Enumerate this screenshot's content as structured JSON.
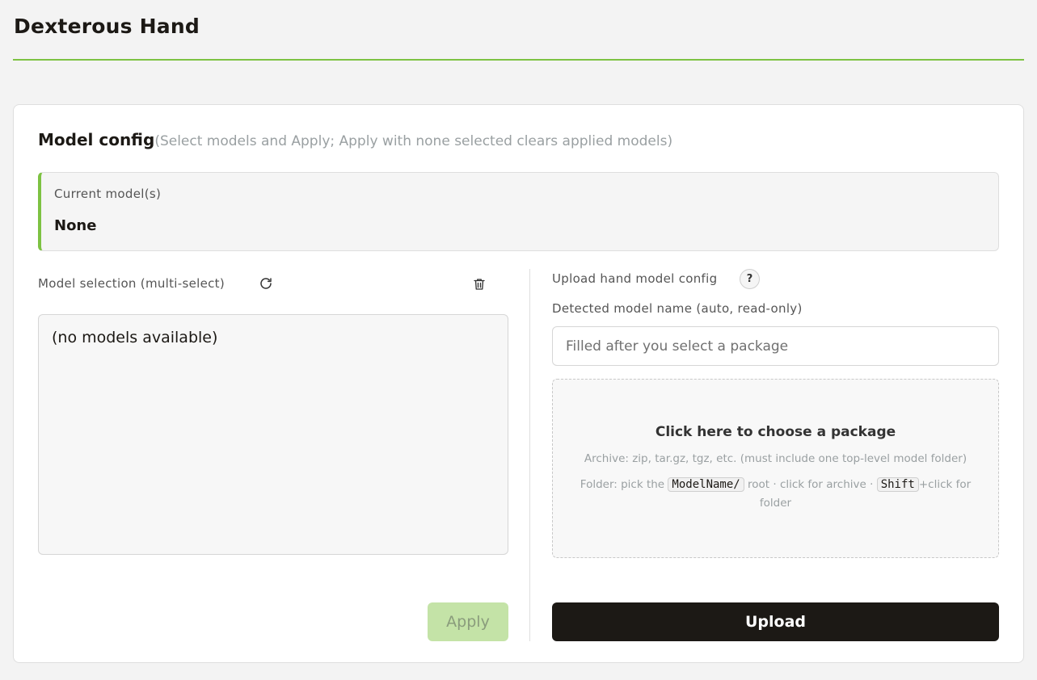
{
  "page": {
    "title": "Dexterous Hand"
  },
  "colors": {
    "accent": "#7dc242",
    "apply_disabled_bg": "#c4e3a7",
    "upload_bg": "#1c1915"
  },
  "model_config": {
    "title": "Model config",
    "hint": "(Select models and Apply; Apply with none selected clears applied models)",
    "current_label": "Current model(s)",
    "current_value": "None",
    "selection": {
      "label": "Model selection (multi-select)",
      "refresh_icon": "refresh-icon",
      "clear_icon": "trash-icon",
      "empty_text": "(no models available)",
      "apply_label": "Apply"
    },
    "upload": {
      "label": "Upload hand model config",
      "help_label": "?",
      "detected_label": "Detected model name (auto, read-only)",
      "name_placeholder": "Filled after you select a package",
      "dropzone_title": "Click here to choose a package",
      "dropzone_archive_hint": "Archive: zip, tar.gz, tgz, etc. (must include one top-level model folder)",
      "dropzone_folder_prefix": "Folder: pick the",
      "dropzone_folder_code": "ModelName/",
      "dropzone_folder_mid": "root · click for archive ·",
      "dropzone_folder_key": "Shift",
      "dropzone_folder_suffix": "+click for folder",
      "upload_label": "Upload"
    }
  }
}
